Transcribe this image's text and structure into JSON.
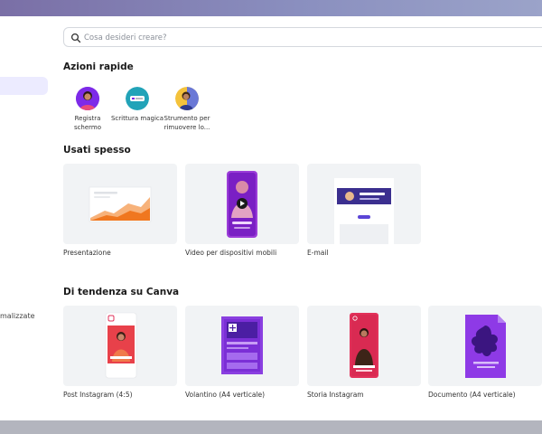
{
  "search": {
    "placeholder": "Cosa desideri creare?"
  },
  "sidebar": {
    "items": [
      {
        "label": "malizzate"
      }
    ]
  },
  "quick_actions": {
    "title": "Azioni rapide",
    "items": [
      {
        "label_line1": "Registra",
        "label_line2": "schermo",
        "icon": "person-avatar-icon"
      },
      {
        "label_line1": "Scrittura magica",
        "label_line2": "",
        "icon": "magic-write-icon"
      },
      {
        "label_line1": "Strumento per",
        "label_line2": "rimuovere lo...",
        "icon": "background-remover-icon"
      }
    ]
  },
  "frequent": {
    "title": "Usati spesso",
    "items": [
      {
        "label": "Presentazione"
      },
      {
        "label": "Video per dispositivi mobili"
      },
      {
        "label": "E-mail"
      }
    ]
  },
  "trending": {
    "title": "Di tendenza su Canva",
    "items": [
      {
        "label": "Post Instagram (4:5)"
      },
      {
        "label": "Volantino (A4 verticale)"
      },
      {
        "label": "Storia Instagram"
      },
      {
        "label": "Documento (A4 verticale)"
      }
    ]
  },
  "colors": {
    "accent": "#7d2ae8",
    "highlight": "#ecebff",
    "card_bg": "#f1f3f5"
  }
}
